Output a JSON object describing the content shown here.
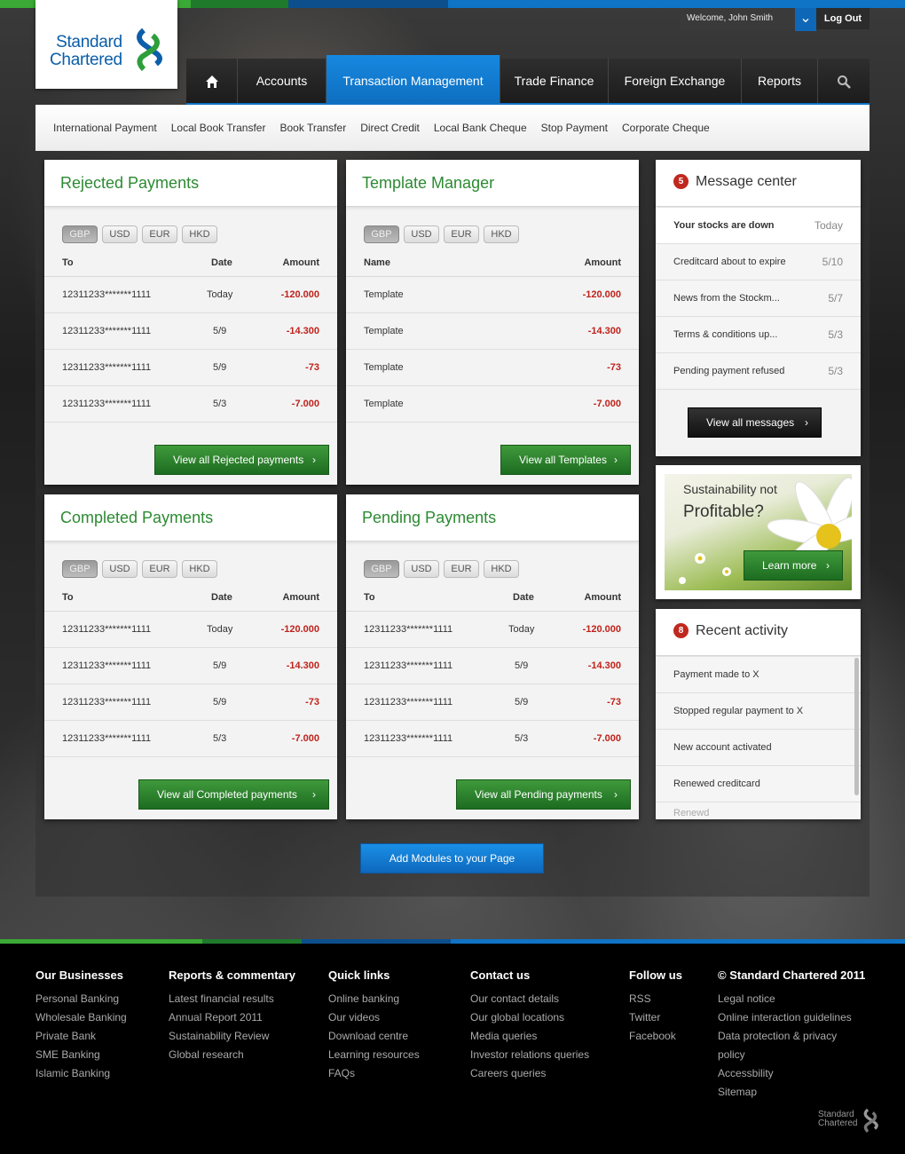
{
  "brand": {
    "name_line1": "Standard",
    "name_line2": "Chartered"
  },
  "user": {
    "welcome": "Welcome, John Smith",
    "logout": "Log Out"
  },
  "nav": {
    "items": [
      "Accounts",
      "Transaction Management",
      "Trade Finance",
      "Foreign Exchange",
      "Reports"
    ],
    "active": "Transaction Management"
  },
  "subnav": [
    "International Payment",
    "Local Book Transfer",
    "Book Transfer",
    "Direct Credit",
    "Local Bank Cheque",
    "Stop Payment",
    "Corporate Cheque"
  ],
  "currencies": [
    "GBP",
    "USD",
    "EUR",
    "HKD"
  ],
  "selected_currency": "GBP",
  "rejected": {
    "title": "Rejected Payments",
    "headers": [
      "To",
      "Date",
      "Amount"
    ],
    "rows": [
      {
        "to": "12311233*******1111",
        "date": "Today",
        "amount": "-120.000"
      },
      {
        "to": "12311233*******1111",
        "date": "5/9",
        "amount": "-14.300"
      },
      {
        "to": "12311233*******1111",
        "date": "5/9",
        "amount": "-73"
      },
      {
        "to": "12311233*******1111",
        "date": "5/3",
        "amount": "-7.000"
      }
    ],
    "button": "View all Rejected payments"
  },
  "templates": {
    "title": "Template Manager",
    "headers": [
      "Name",
      "Amount"
    ],
    "rows": [
      {
        "name": "Template",
        "amount": "-120.000"
      },
      {
        "name": "Template",
        "amount": "-14.300"
      },
      {
        "name": "Template",
        "amount": "-73"
      },
      {
        "name": "Template",
        "amount": "-7.000"
      }
    ],
    "button": "View all Templates"
  },
  "completed": {
    "title": "Completed Payments",
    "headers": [
      "To",
      "Date",
      "Amount"
    ],
    "rows": [
      {
        "to": "12311233*******1111",
        "date": "Today",
        "amount": "-120.000"
      },
      {
        "to": "12311233*******1111",
        "date": "5/9",
        "amount": "-14.300"
      },
      {
        "to": "12311233*******1111",
        "date": "5/9",
        "amount": "-73"
      },
      {
        "to": "12311233*******1111",
        "date": "5/3",
        "amount": "-7.000"
      }
    ],
    "button": "View all Completed payments"
  },
  "pending": {
    "title": "Pending Payments",
    "headers": [
      "To",
      "Date",
      "Amount"
    ],
    "rows": [
      {
        "to": "12311233*******1111",
        "date": "Today",
        "amount": "-120.000"
      },
      {
        "to": "12311233*******1111",
        "date": "5/9",
        "amount": "-14.300"
      },
      {
        "to": "12311233*******1111",
        "date": "5/9",
        "amount": "-73"
      },
      {
        "to": "12311233*******1111",
        "date": "5/3",
        "amount": "-7.000"
      }
    ],
    "button": "View all Pending payments"
  },
  "messages": {
    "count": "5",
    "title": "Message center",
    "items": [
      {
        "text": "Your stocks are down",
        "date": "Today"
      },
      {
        "text": "Creditcard about to expire",
        "date": "5/10"
      },
      {
        "text": "News from the Stockm...",
        "date": "5/7"
      },
      {
        "text": "Terms & conditions up...",
        "date": "5/3"
      },
      {
        "text": "Pending payment refused",
        "date": "5/3"
      }
    ],
    "button": "View all messages"
  },
  "promo": {
    "line1": "Sustainability not",
    "line2": "Profitable?",
    "button": "Learn more"
  },
  "activity": {
    "count": "8",
    "title": "Recent activity",
    "items": [
      "Payment made to X",
      "Stopped regular payment to X",
      "New account activated",
      "Renewed creditcard",
      "Renewd"
    ]
  },
  "add_modules": "Add Modules to your Page",
  "footer": {
    "columns": [
      {
        "title": "Our Businesses",
        "links": [
          "Personal Banking",
          "Wholesale Banking",
          "Private Bank",
          "SME Banking",
          "Islamic Banking"
        ]
      },
      {
        "title": "Reports & commentary",
        "links": [
          "Latest financial results",
          "Annual Report 2011",
          "Sustainability Review",
          "Global research"
        ]
      },
      {
        "title": "Quick links",
        "links": [
          "Online banking",
          "Our videos",
          "Download centre",
          "Learning resources",
          "FAQs"
        ]
      },
      {
        "title": "Contact us",
        "links": [
          "Our contact details",
          "Our global locations",
          "Media queries",
          "Investor relations queries",
          "Careers queries"
        ]
      },
      {
        "title": "Follow us",
        "links": [
          "RSS",
          "Twitter",
          "Facebook"
        ]
      },
      {
        "title": "© Standard Chartered 2011",
        "links": [
          "Legal notice",
          "Online interaction guidelines",
          "Data protection & privacy",
          "policy",
          "Accessbility",
          "Sitemap"
        ]
      }
    ],
    "logo_line1": "Standard",
    "logo_line2": "Chartered"
  },
  "colors": {
    "brand_green": "#2c8a32",
    "brand_blue": "#0f73c6",
    "amount_red": "#c0221b"
  }
}
